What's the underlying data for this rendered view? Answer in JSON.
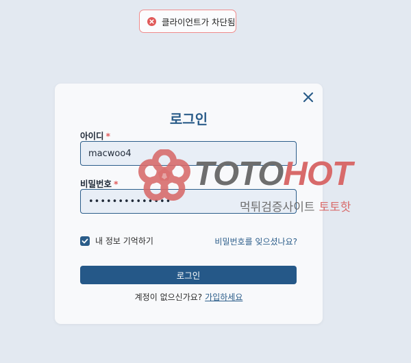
{
  "toast": {
    "message": "클라이언트가 차단됨",
    "icon": "error-circle-icon",
    "color": "#e05a5a"
  },
  "login": {
    "title": "로그인",
    "id_label": "아이디",
    "id_value": "macwoo4",
    "password_label": "비밀번호",
    "password_value": "••••••••••••••",
    "required_mark": "*",
    "remember_label": "내 정보 기억하기",
    "remember_checked": true,
    "forgot_link": "비밀번호를 잊으셨나요?",
    "submit_label": "로그인",
    "no_account_text": "계정이 없으신가요?",
    "signup_link": "가입하세요"
  },
  "watermark": {
    "brand_part1": "TOTO",
    "brand_part2": "HOT",
    "subtitle": "먹튀검증사이트",
    "subtitle_accent": "토토핫"
  },
  "colors": {
    "accent": "#2a5c89",
    "button": "#255888",
    "error": "#e05a5a",
    "background": "#e3e9f1"
  }
}
